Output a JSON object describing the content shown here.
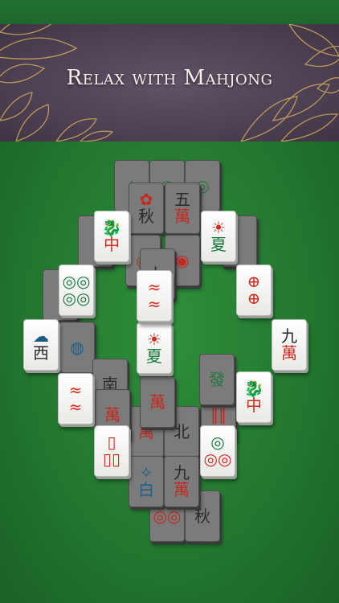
{
  "banner": {
    "title": "Relax with Mahjong"
  },
  "colors": {
    "felt": "#23782f",
    "banner": "#4c3f51",
    "gold": "#c9a45c",
    "tile_face": "#ffffff",
    "tile_dim": "#7b7b7b"
  },
  "tiles": [
    {
      "c1": "",
      "c2": ""
    },
    {
      "c1": "",
      "c2": ""
    },
    {
      "c1": "",
      "c2": ""
    },
    {
      "c1": "秋",
      "c2": ""
    },
    {
      "c1": "五",
      "c2": "萬"
    },
    {
      "c1": "",
      "c2": ""
    },
    {
      "c1": "中",
      "c2": ""
    },
    {
      "c1": "",
      "c2": "夏"
    },
    {
      "c1": "",
      "c2": ""
    },
    {
      "c1": "",
      "c2": ""
    },
    {
      "c1": "七",
      "c2": ""
    },
    {
      "c1": "",
      "c2": ""
    },
    {
      "c1": "",
      "c2": ""
    },
    {
      "c1": "",
      "c2": ""
    },
    {
      "c1": "",
      "c2": ""
    },
    {
      "c1": "西",
      "c2": ""
    },
    {
      "c1": "",
      "c2": ""
    },
    {
      "c1": "南",
      "c2": ""
    },
    {
      "c1": "",
      "c2": "夏"
    },
    {
      "c1": "",
      "c2": ""
    },
    {
      "c1": "九",
      "c2": "萬"
    },
    {
      "c1": "",
      "c2": ""
    },
    {
      "c1": "萬",
      "c2": ""
    },
    {
      "c1": "萬",
      "c2": ""
    },
    {
      "c1": "發",
      "c2": ""
    },
    {
      "c1": "",
      "c2": ""
    },
    {
      "c1": "中",
      "c2": ""
    },
    {
      "c1": "萬",
      "c2": ""
    },
    {
      "c1": "北",
      "c2": ""
    },
    {
      "c1": "",
      "c2": ""
    },
    {
      "c1": "",
      "c2": ""
    },
    {
      "c1": "白",
      "c2": ""
    },
    {
      "c1": "九",
      "c2": "萬"
    },
    {
      "c1": "",
      "c2": ""
    },
    {
      "c1": "秋",
      "c2": ""
    }
  ]
}
